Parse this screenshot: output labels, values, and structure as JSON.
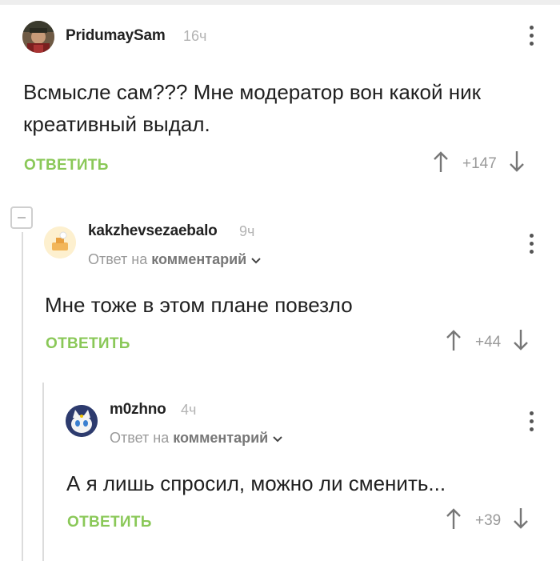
{
  "comments": [
    {
      "author": "PridumaySam",
      "time": "16ч",
      "text": "Всмысле сам??? Мне модератор вон какой ник креативный выдал.",
      "reply_label": "ОТВЕТИТЬ",
      "score": "+147"
    },
    {
      "author": "kakzhevsezaebalo",
      "time": "9ч",
      "reply_to_prefix": "Ответ на",
      "reply_to_target": "комментарий",
      "text": "Мне тоже в этом плане повезло",
      "reply_label": "ОТВЕТИТЬ",
      "score": "+44"
    },
    {
      "author": "m0zhno",
      "time": "4ч",
      "reply_to_prefix": "Ответ на",
      "reply_to_target": "комментарий",
      "text": "А я лишь спросил, можно ли сменить...",
      "reply_label": "ОТВЕТИТЬ",
      "score": "+39"
    }
  ],
  "colors": {
    "accent_green": "#8ac858",
    "muted_gray": "#9a9a9a",
    "thread_line": "#dcdcdc"
  },
  "icons": {
    "upvote": "arrow-up-icon",
    "downvote": "arrow-down-icon",
    "menu": "more-vertical-icon",
    "collapse": "minus-icon",
    "dropdown": "chevron-down-icon"
  }
}
